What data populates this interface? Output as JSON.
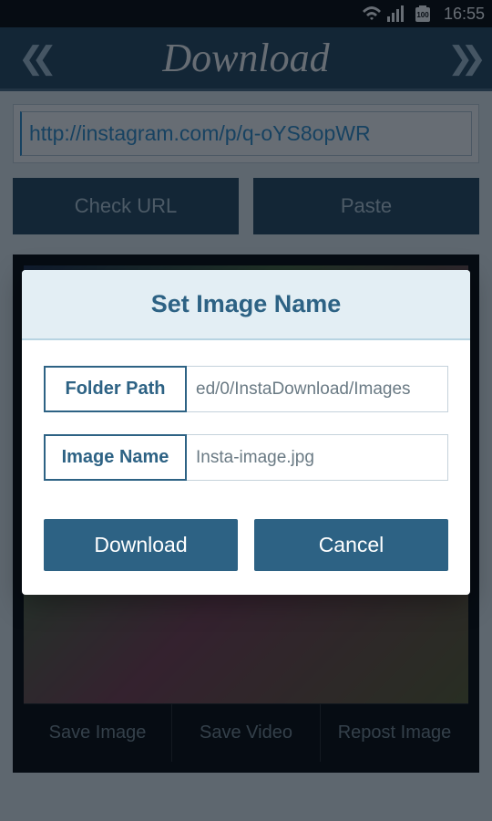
{
  "status": {
    "time": "16:55",
    "battery": "100"
  },
  "header": {
    "title": "Download"
  },
  "url": {
    "value": "http://instagram.com/p/q-oYS8opWR"
  },
  "buttons": {
    "check": "Check URL",
    "paste": "Paste"
  },
  "actions": {
    "save_image": "Save Image",
    "save_video": "Save Video",
    "repost": "Repost Image"
  },
  "dialog": {
    "title": "Set Image Name",
    "folder_label": "Folder Path",
    "folder_value": "ed/0/InstaDownload/Images",
    "name_label": "Image Name",
    "name_value": "Insta-image.jpg",
    "download": "Download",
    "cancel": "Cancel"
  }
}
